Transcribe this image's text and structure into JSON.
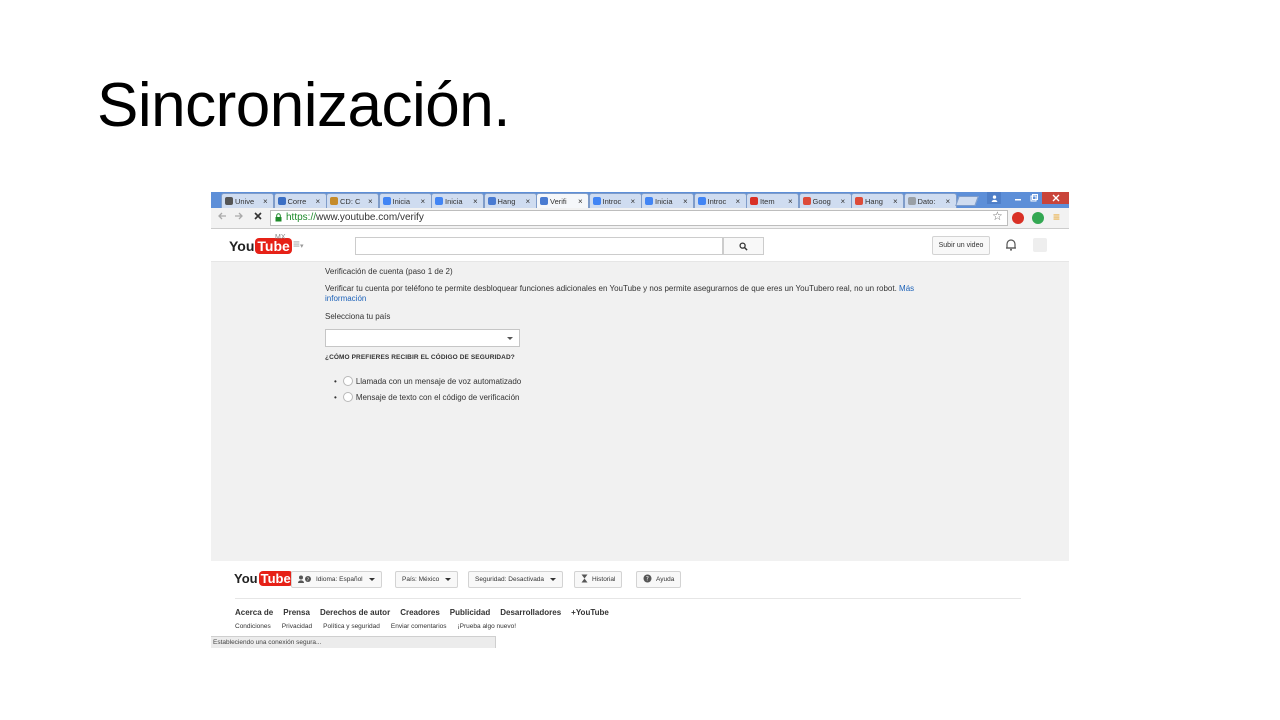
{
  "slide": {
    "title": "Sincronización."
  },
  "browser": {
    "tabs": [
      {
        "label": "Unive",
        "favicon": "globe-icon",
        "active": false
      },
      {
        "label": "Corre",
        "favicon": "mail-icon",
        "active": false
      },
      {
        "label": "CD: C",
        "favicon": "book-icon",
        "active": false
      },
      {
        "label": "Inicia",
        "favicon": "google-sites-icon",
        "active": false
      },
      {
        "label": "Inicia",
        "favicon": "google-sites-icon",
        "active": false
      },
      {
        "label": "Hang",
        "favicon": "loading-icon",
        "active": false
      },
      {
        "label": "Verifi",
        "favicon": "loading-icon",
        "active": true
      },
      {
        "label": "Introc",
        "favicon": "google-sites-icon",
        "active": false
      },
      {
        "label": "Inicia",
        "favicon": "google-sites-icon",
        "active": false
      },
      {
        "label": "Introc",
        "favicon": "google-sites-icon",
        "active": false
      },
      {
        "label": "Item",
        "favicon": "gmail-icon",
        "active": false
      },
      {
        "label": "Goog",
        "favicon": "google-plus-icon",
        "active": false
      },
      {
        "label": "Hang",
        "favicon": "google-plus-icon",
        "active": false
      },
      {
        "label": "Dato:",
        "favicon": "document-icon",
        "active": false
      }
    ],
    "tab_close_glyph": "×",
    "url_scheme": "https://",
    "url_rest": "www.youtube.com/verify",
    "status_text": "Estableciendo una conexión segura..."
  },
  "youtube": {
    "logo_you": "You",
    "logo_tube": "Tube",
    "country_code": "MX",
    "upload_label": "Subir un video"
  },
  "verify": {
    "title": "Verificación de cuenta (paso 1 de 2)",
    "description": "Verificar tu cuenta por teléfono te permite desbloquear funciones adicionales en YouTube y nos permite asegurarnos de que eres un YouTubero real, no un robot.",
    "more_link": "Más información",
    "country_label": "Selecciona tu país",
    "country_value": "",
    "method_question": "¿CÓMO PREFIERES RECIBIR EL CÓDIGO DE SEGURIDAD?",
    "options": [
      "Llamada con un mensaje de voz automatizado",
      "Mensaje de texto con el código de verificación"
    ]
  },
  "footer": {
    "language_label": "Idioma:",
    "language_value": "Español",
    "country_label": "País:",
    "country_value": "México",
    "safety_label": "Seguridad:",
    "safety_value": "Desactivada",
    "history_label": "Historial",
    "help_label": "Ayuda",
    "links_primary": [
      "Acerca de",
      "Prensa",
      "Derechos de autor",
      "Creadores",
      "Publicidad",
      "Desarrolladores",
      "+YouTube"
    ],
    "links_secondary": [
      "Condiciones",
      "Privacidad",
      "Política y seguridad",
      "Enviar comentarios",
      "¡Prueba algo nuevo!"
    ]
  },
  "colors": {
    "youtube_red": "#e62117",
    "link_blue": "#1c62b9",
    "tabstrip_blue": "#5d8fd8",
    "https_green": "#1d8a2a"
  }
}
